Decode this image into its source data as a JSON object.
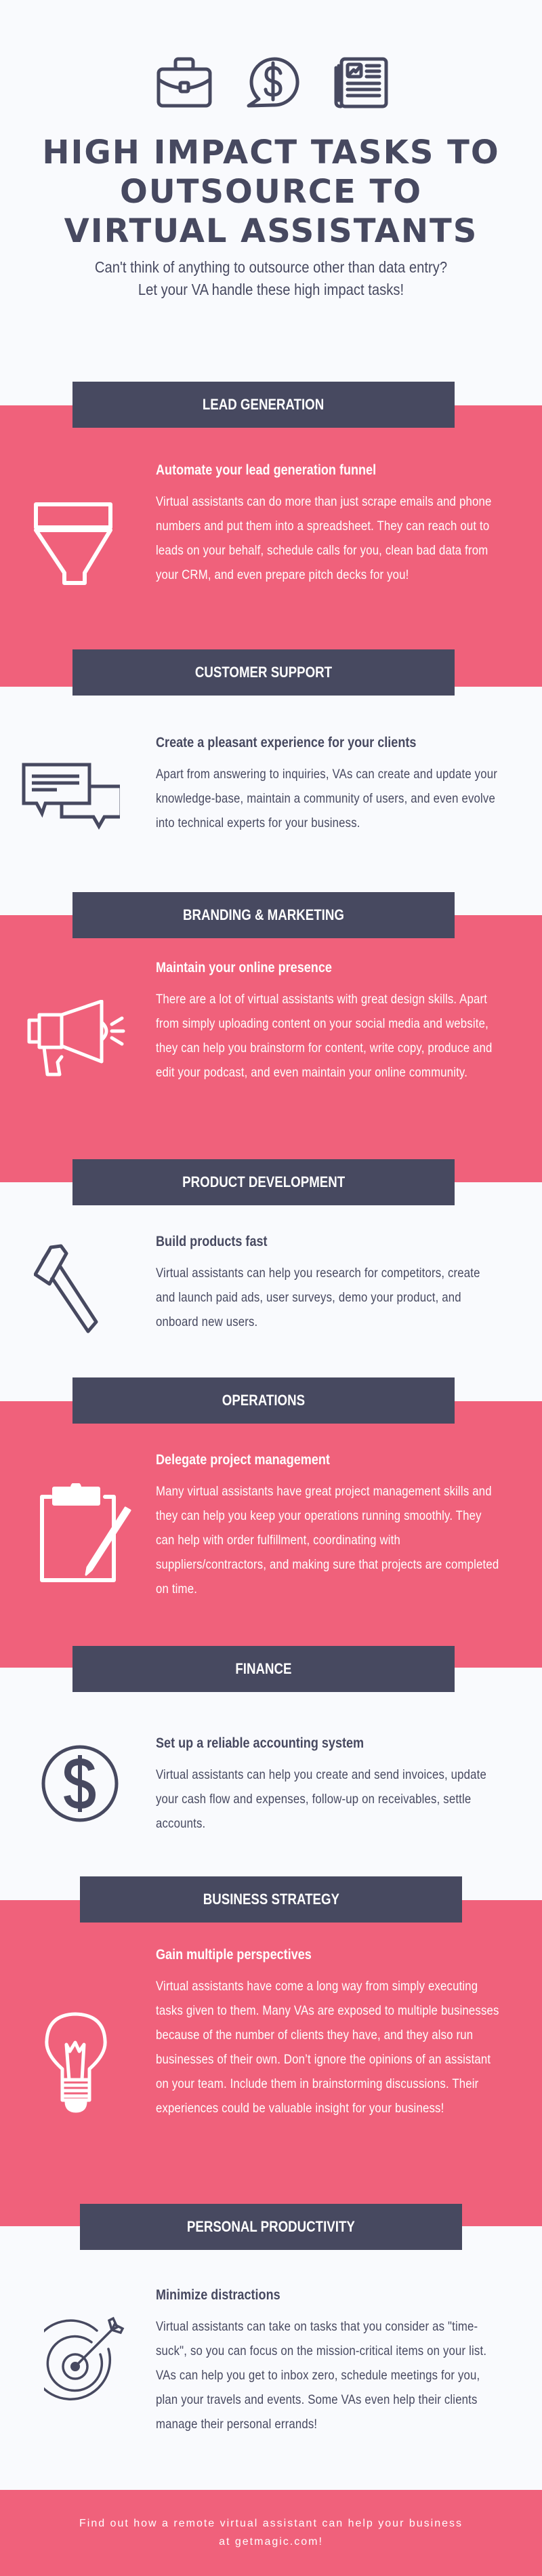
{
  "header": {
    "icons": [
      "briefcase-icon",
      "dollar-speech-bubble-icon",
      "newspaper-icon"
    ],
    "title": "HIGH IMPACT TASKS TO OUTSOURCE TO VIRTUAL ASSISTANTS",
    "subtitle": "Can't think of anything to outsource other than data entry? Let your VA handle these high impact tasks!"
  },
  "colors": {
    "accent_pink": "#F0617B",
    "dark_navy": "#474960",
    "background": "#F9FAFD",
    "white": "#FFFFFF"
  },
  "sections": [
    {
      "category": "LEAD GENERATION",
      "icon": "funnel-icon",
      "heading": "Automate your lead generation funnel",
      "body": "Virtual assistants can do more than just scrape emails and phone numbers and put them into a spreadsheet. They can reach out to leads on your behalf, schedule calls for you, clean bad data from your CRM, and even prepare pitch decks for you!"
    },
    {
      "category": "CUSTOMER SUPPORT",
      "icon": "chat-bubbles-icon",
      "heading": "Create a pleasant experience for your clients",
      "body": "Apart from answering to inquiries, VAs can create and update your knowledge-base, maintain a community of users, and even evolve into technical experts for your business."
    },
    {
      "category": "BRANDING & MARKETING",
      "icon": "megaphone-icon",
      "heading": "Maintain your online presence",
      "body": "There are a lot of virtual assistants with great design skills. Apart from simply uploading content on your social media and website, they can help you brainstorm for content, write copy, produce and edit your podcast, and even maintain your online community."
    },
    {
      "category": "PRODUCT DEVELOPMENT",
      "icon": "hammer-icon",
      "heading": "Build products fast",
      "body": "Virtual assistants can help you research for competitors, create and launch paid ads, user surveys, demo your product, and onboard new users."
    },
    {
      "category": "OPERATIONS",
      "icon": "clipboard-pencil-icon",
      "heading": "Delegate project management",
      "body": "Many virtual assistants have great project management skills and they can help you keep your operations running smoothly. They can help with order fulfillment, coordinating with suppliers/contractors, and making sure that projects are completed on time."
    },
    {
      "category": "FINANCE",
      "icon": "dollar-coin-icon",
      "heading": "Set up a reliable accounting system",
      "body": "Virtual assistants can help you create and send invoices, update your cash flow and expenses, follow-up on receivables, settle accounts."
    },
    {
      "category": "BUSINESS STRATEGY",
      "icon": "lightbulb-icon",
      "heading": "Gain multiple perspectives",
      "body": "Virtual assistants have come a long way from simply executing tasks given to them. Many VAs are exposed to multiple businesses because of the number of clients they have, and they also run businesses of their own. Don’t ignore the opinions of an assistant on your team. Include them in brainstorming discussions. Their experiences could be valuable insight for your business!"
    },
    {
      "category": "PERSONAL PRODUCTIVITY",
      "icon": "target-arrow-icon",
      "heading": "Minimize distractions",
      "body": "Virtual assistants can take on tasks that you consider as \"time-suck\", so you can focus on the mission-critical items on your list. VAs can help you get to inbox zero, schedule meetings for you, plan your travels and events. Some VAs even help their clients manage their personal errands!"
    }
  ],
  "footer": {
    "line1": "Find out how a remote virtual assistant can help your business",
    "line2": "at getmagic.com!"
  }
}
